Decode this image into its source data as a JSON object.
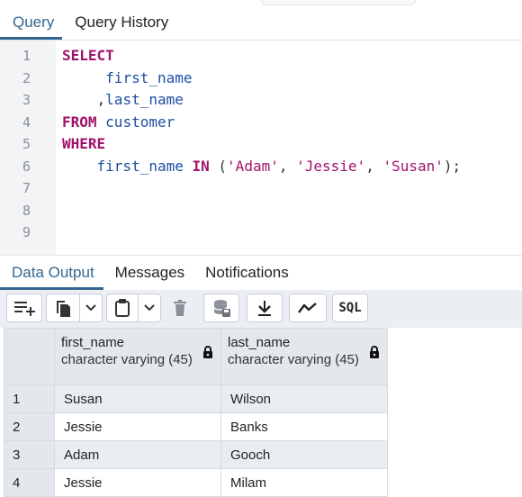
{
  "editor_tabs": [
    {
      "label": "Query",
      "active": true
    },
    {
      "label": "Query History",
      "active": false
    }
  ],
  "line_numbers": [
    "1",
    "2",
    "3",
    "4",
    "5",
    "6",
    "7",
    "8",
    "9"
  ],
  "sql": {
    "l1_kw": "SELECT",
    "l2_col": "first_name",
    "l3_comma": ",",
    "l3_col": "last_name",
    "l4_kw": "FROM",
    "l4_table": "customer",
    "l5_kw": "WHERE",
    "l6_col": "first_name",
    "l6_kw": "IN",
    "l6_open": "(",
    "l6_v1": "'Adam'",
    "l6_v2": "'Jessie'",
    "l6_v3": "'Susan'",
    "l6_close": ");",
    "comma": ","
  },
  "result_tabs": [
    {
      "label": "Data Output",
      "active": true
    },
    {
      "label": "Messages",
      "active": false
    },
    {
      "label": "Notifications",
      "active": false
    }
  ],
  "toolbar": {
    "icons": [
      "add-row-icon",
      "copy-icon",
      "chevron-down-icon",
      "paste-icon",
      "chevron-down-icon",
      "delete-icon",
      "save-data-icon",
      "download-icon",
      "graph-icon",
      "sql-icon"
    ],
    "sql_label": "SQL"
  },
  "grid": {
    "columns": [
      {
        "name": "first_name",
        "type": "character varying (45)"
      },
      {
        "name": "last_name",
        "type": "character varying (45)"
      }
    ],
    "rows": [
      {
        "num": "1",
        "cells": [
          "Susan",
          "Wilson"
        ]
      },
      {
        "num": "2",
        "cells": [
          "Jessie",
          "Banks"
        ]
      },
      {
        "num": "3",
        "cells": [
          "Adam",
          "Gooch"
        ]
      },
      {
        "num": "4",
        "cells": [
          "Jessie",
          "Milam"
        ]
      }
    ]
  },
  "colors": {
    "accent": "#326690",
    "keyword": "#a0126b",
    "identifier": "#1d4fa3"
  }
}
